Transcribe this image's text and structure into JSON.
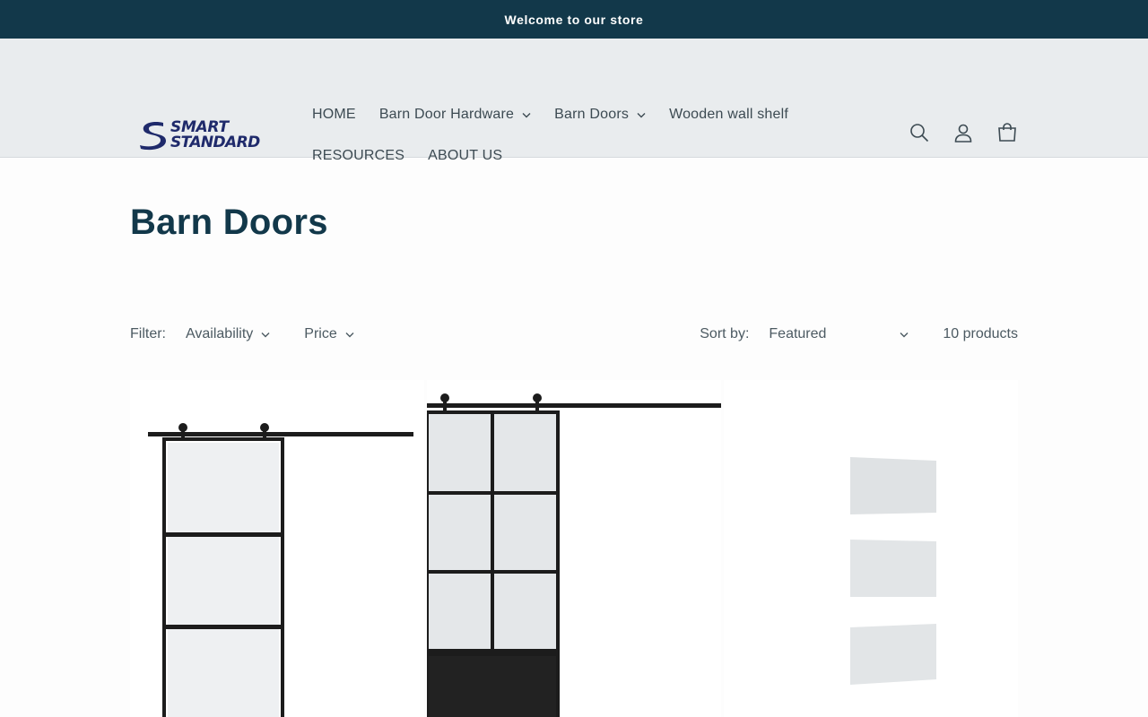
{
  "announcement": "Welcome to our store",
  "brand": {
    "line1": "SMART",
    "line2": "STANDARD"
  },
  "nav": {
    "row1": [
      {
        "label": "HOME",
        "dropdown": false
      },
      {
        "label": "Barn Door Hardware",
        "dropdown": true
      },
      {
        "label": "Barn Doors",
        "dropdown": true
      },
      {
        "label": "Wooden wall shelf",
        "dropdown": false
      }
    ],
    "row2": [
      {
        "label": "RESOURCES",
        "dropdown": false
      },
      {
        "label": "ABOUT US",
        "dropdown": false
      }
    ]
  },
  "header_icons": [
    "search-icon",
    "account-icon",
    "cart-icon"
  ],
  "page_title": "Barn Doors",
  "filters": {
    "label": "Filter:",
    "availability": "Availability",
    "price": "Price"
  },
  "sort": {
    "label": "Sort by:",
    "selected": "Featured"
  },
  "product_count": "10 products",
  "colors": {
    "announcement_bg": "#12384a",
    "header_bg": "#e9ecee",
    "title": "#12384a"
  }
}
